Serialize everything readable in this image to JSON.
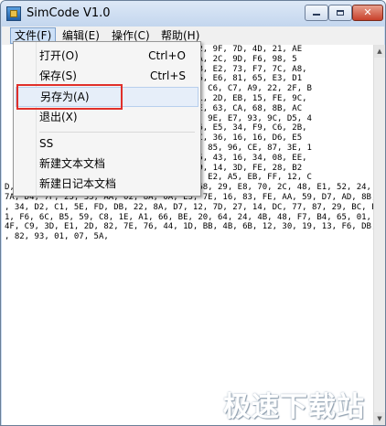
{
  "window": {
    "title": "SimCode V1.0",
    "minimize_glyph": "",
    "close_glyph": "✕"
  },
  "menubar": {
    "items": [
      "文件(F)",
      "编辑(E)",
      "操作(C)",
      "帮助(H)"
    ]
  },
  "file_menu": {
    "items": [
      {
        "label": "打开(O)",
        "shortcut": "Ctrl+O"
      },
      {
        "label": "保存(S)",
        "shortcut": "Ctrl+S"
      },
      {
        "label": "另存为(A)",
        "shortcut": ""
      },
      {
        "label": "退出(X)",
        "shortcut": ""
      },
      {
        "label": "SS",
        "shortcut": ""
      },
      {
        "label": "新建文本文档",
        "shortcut": ""
      },
      {
        "label": "新建日记本文档",
        "shortcut": ""
      }
    ]
  },
  "editor": {
    "lines": [
      "                      66, 8D, 9B, 2B, C2, 9F, 7D, 4D, 21, AE",
      "                      3E, 4F, 31, 96, 6A, 2C, 9D, F6, 98, 5",
      "                      25, D2, 60, 3C, CB, E2, 73, F7, 7C, A8,",
      "                      B4, 30, B5, 4C, 36, E6, 81, 65, E3, D1",
      "                      7, 7A, 2B, 47, 4E, C6, C7, A9, 22, 2F, B",
      "                      0F, 9F, 7D, D6, A1, 2D, EB, 15, FE, 9C,",
      "                      E7, 84, 95, CD, CE, 63, CA, 68, 8B, AC",
      "                      9, 7D, C9, FD, D9, 9E, E7, 93, 9C, D5, 4",
      "                      39, 2D, 3F, F8, 16, E5, 34, F9, C6, 2B,",
      "                      0F, 82, 3F, A8, FC, 36, 16, 16, D6, E5",
      "                      2, D0, 57, DA, 11, 85, 96, CE, 87, 3E, 1",
      "                      10, 48, F9, DC, 05, 43, 16, 34, 08, EE,",
      "                      4C, 31, 2F, 6E, F9, 14, 3D, FE, 28, B2",
      "                      5, D6, F7, 70, 81, E2, A5, EB, FF, 12, C",
      "D, F1, 58, 33, 50, 91, 0C, C7, 3D, F2, 68, 29, E8, 70, 2C, 48, E1, 52, 24, 44, BA, EC,",
      "7A, D4, 7F, 25, 33, AA, 02, 8A, 0A, E3, 7E, 16, 83, FE, AA, 59, D7, AD, 8B, 79, 2F, 91",
      ", 34, D2, C1, 5E, FD, DB, 22, 8A, D7, 12, 7D, 27, 14, DC, 77, 87, 29, BC, F6, 5C, B5, 0",
      "1, F6, 6C, B5, 59, C8, 1E, A1, 66, BE, 20, 64, 24, 4B, 48, F7, B4, 65, 01, 68, 5F, 7B,",
      "4F, C9, 3D, E1, 2D, 82, 7E, 76, 44, 1D, BB, 4B, 6B, 12, 30, 19, 13, F6, DB, C8, EF, 01",
      ", 82, 93, 01, 07, 5A,"
    ]
  },
  "watermark": "极速下载站",
  "colors": {
    "highlight_border": "#e0302a",
    "menu_active_bg": "#cde0f7",
    "titlebar_bg": "#c3d6ee"
  }
}
